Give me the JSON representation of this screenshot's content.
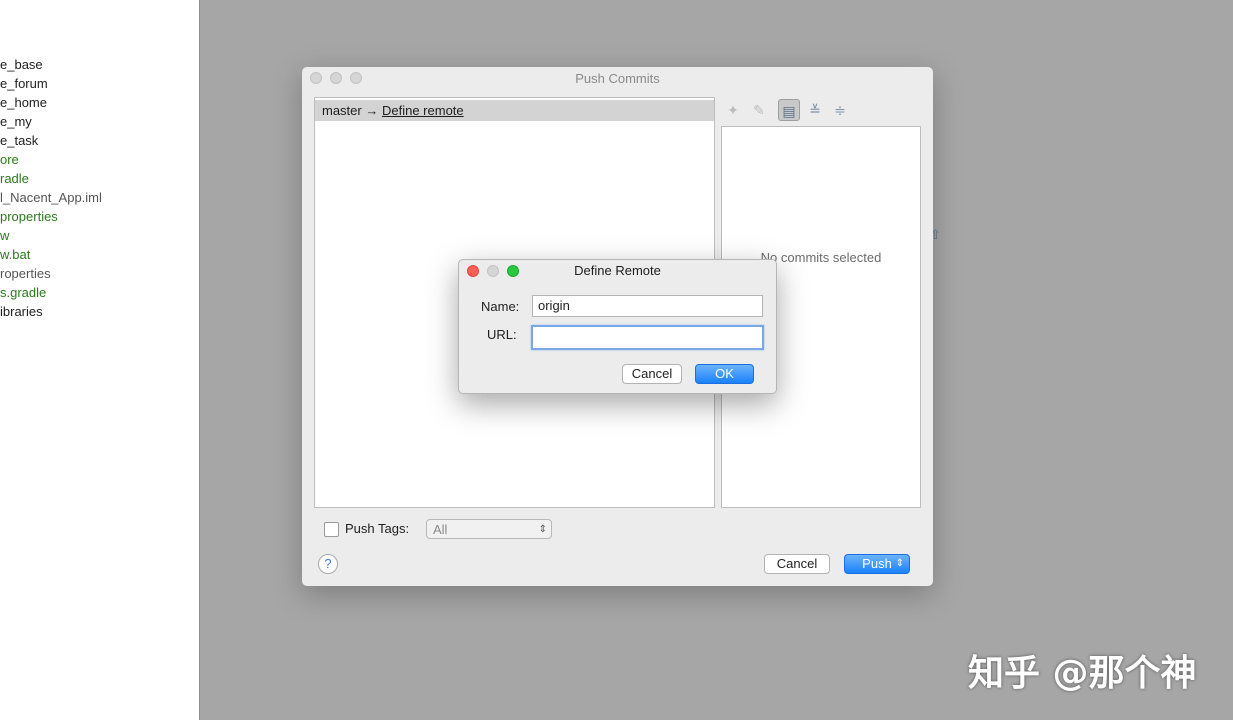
{
  "sidebar": {
    "items": [
      {
        "label": "e_base",
        "tone": "black"
      },
      {
        "label": "e_forum",
        "tone": "black"
      },
      {
        "label": "e_home",
        "tone": "black"
      },
      {
        "label": "e_my",
        "tone": "black"
      },
      {
        "label": "e_task",
        "tone": "black"
      },
      {
        "label": "ore",
        "tone": "green"
      },
      {
        "label": "radle",
        "tone": "green"
      },
      {
        "label": "l_Nacent_App.iml",
        "tone": "gray"
      },
      {
        "label": "properties",
        "tone": "green"
      },
      {
        "label": "w",
        "tone": "green"
      },
      {
        "label": "w.bat",
        "tone": "green"
      },
      {
        "label": "roperties",
        "tone": "gray"
      },
      {
        "label": "s.gradle",
        "tone": "green"
      },
      {
        "label": "ibraries",
        "tone": "black"
      }
    ]
  },
  "push_window": {
    "title": "Push Commits",
    "branch_source": "master",
    "branch_arrow": "→",
    "branch_target_link": "Define remote",
    "no_commits_text": "No commits selected",
    "push_tags_label": "Push Tags:",
    "push_tags_checked": false,
    "tags_select_value": "All",
    "help_label": "?",
    "cancel_label": "Cancel",
    "push_label": "Push",
    "toolbar": {
      "icons": [
        "pin-icon",
        "edit-icon",
        "details-toggle-icon",
        "expand-all-icon",
        "collapse-all-icon"
      ]
    }
  },
  "define_remote_dialog": {
    "title": "Define Remote",
    "name_label": "Name:",
    "name_value": "origin",
    "url_label": "URL:",
    "url_value": "",
    "cancel_label": "Cancel",
    "ok_label": "OK"
  },
  "watermark": "知乎 @那个神",
  "colors": {
    "accent_blue": "#1a82fb",
    "green_file": "#2b7a1c",
    "overlay_gray": "#a6a6a6"
  }
}
